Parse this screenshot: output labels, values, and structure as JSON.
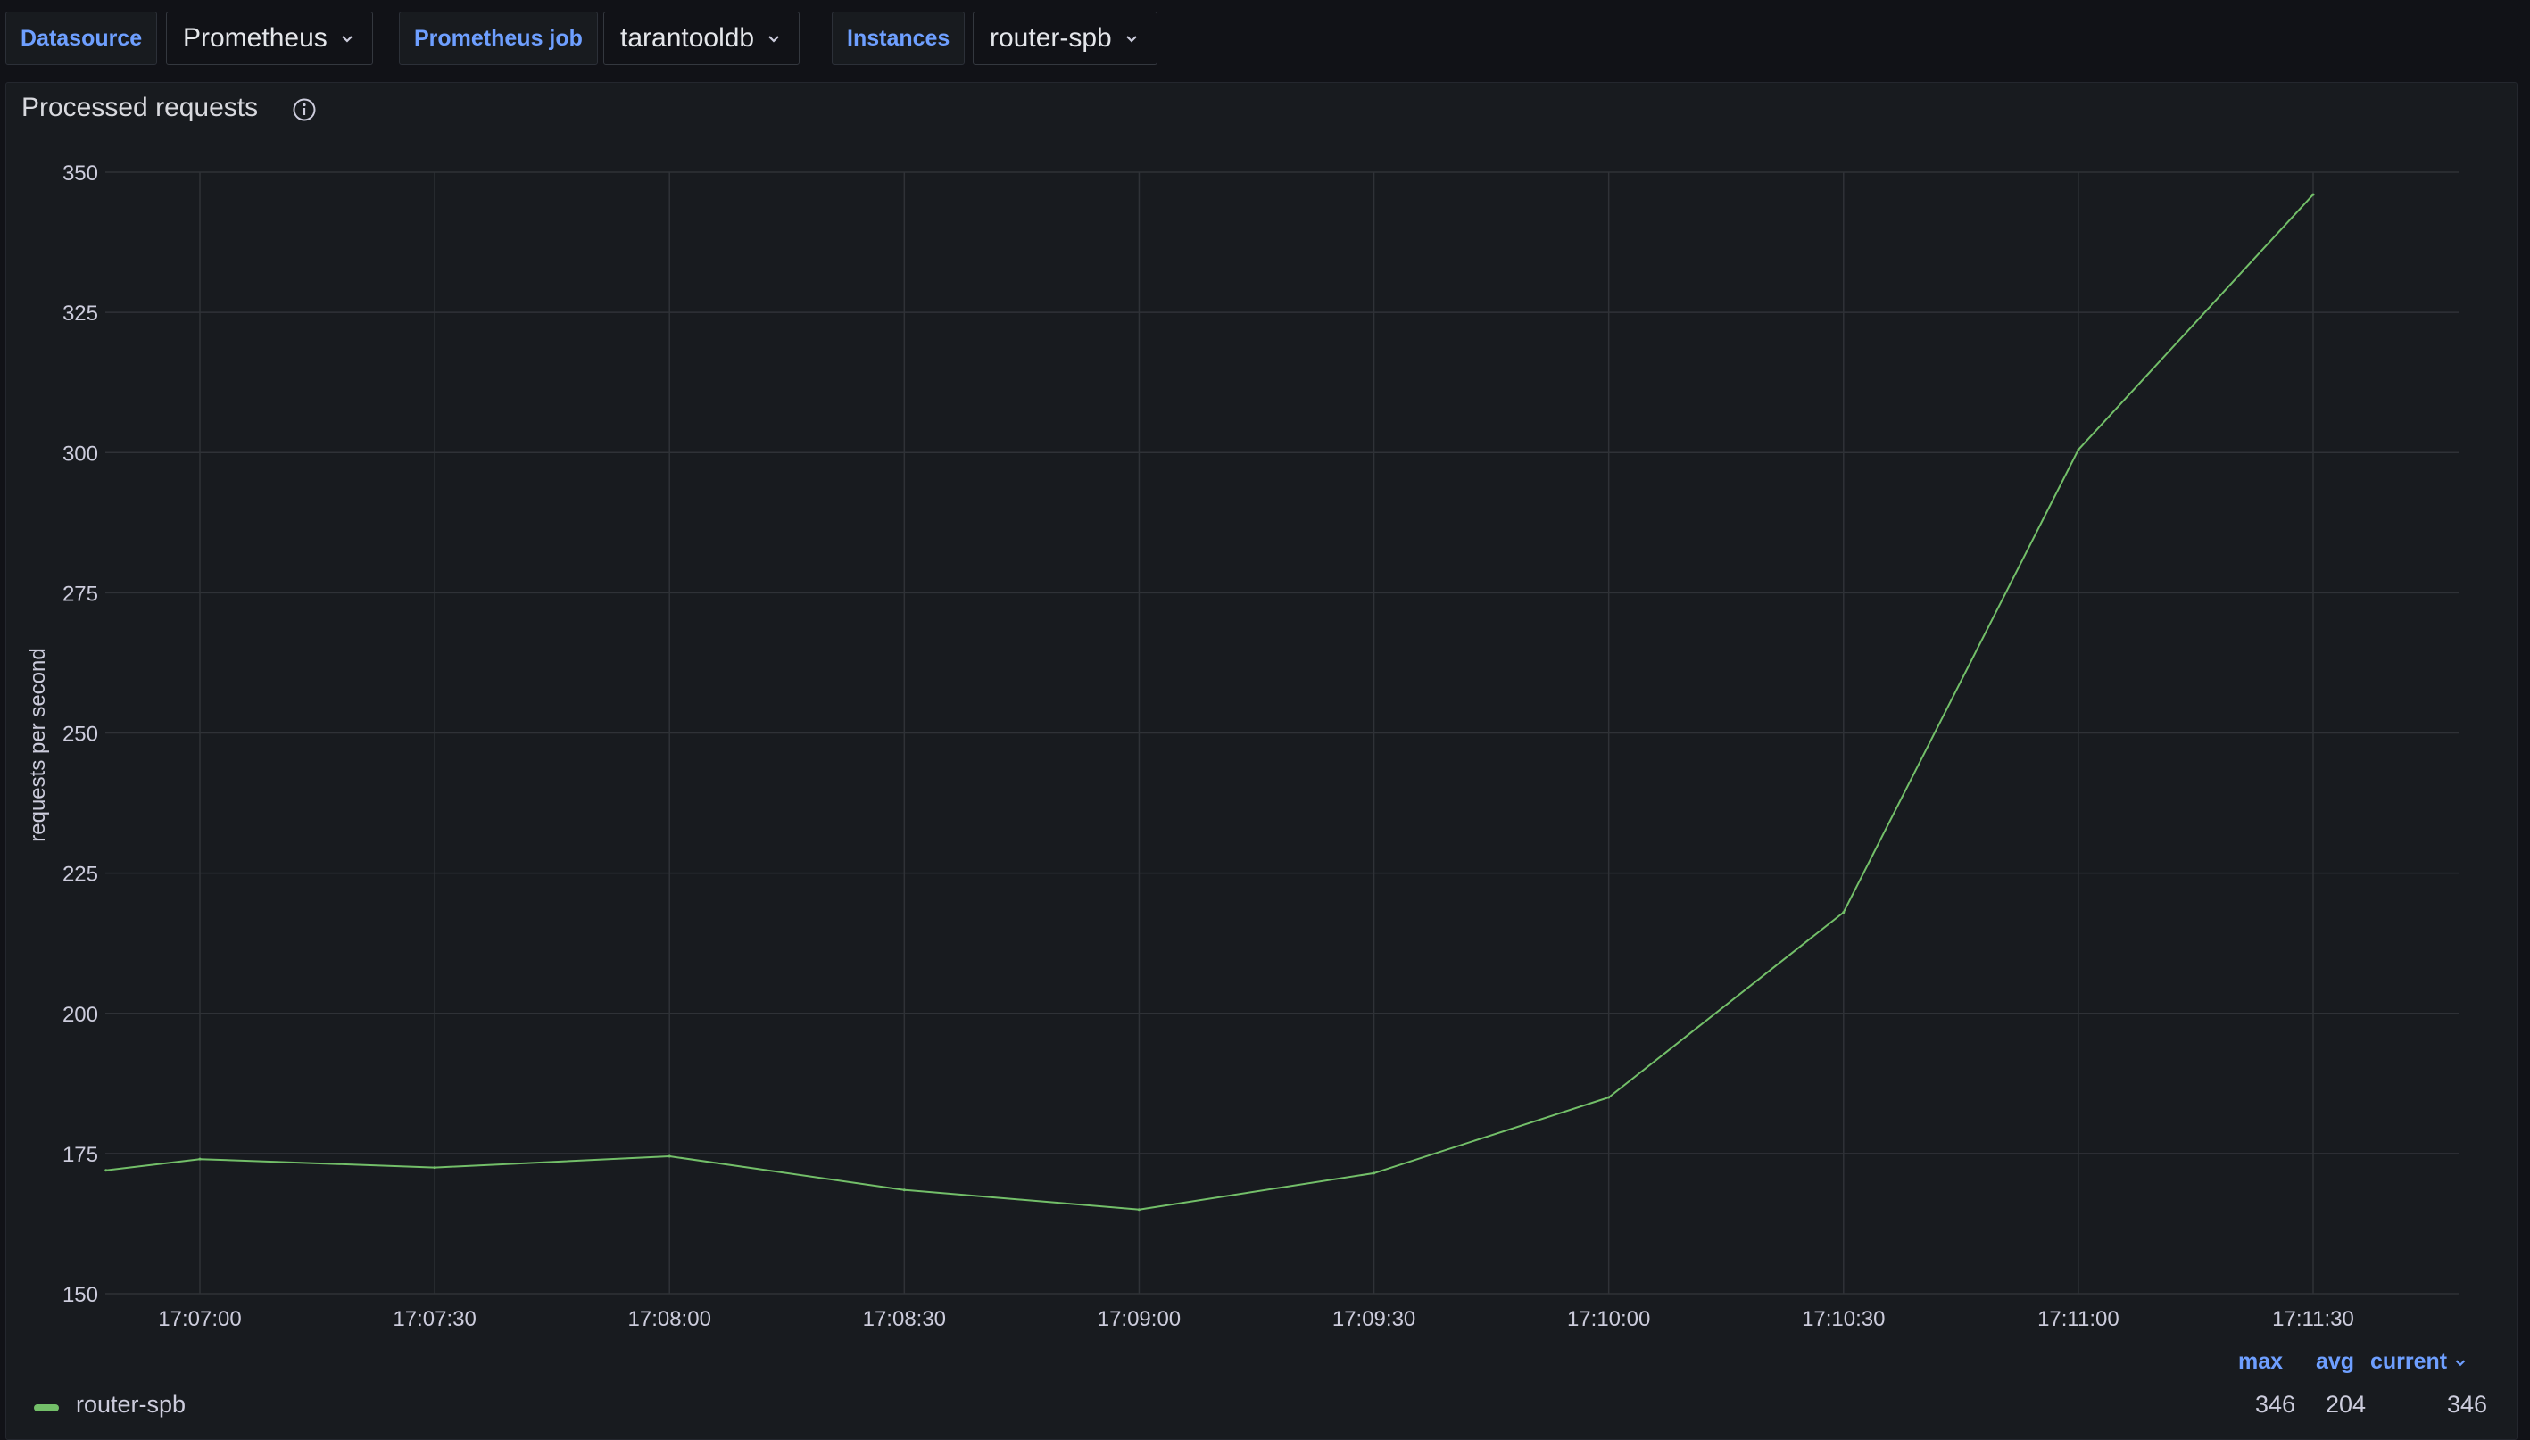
{
  "variables": [
    {
      "label": "Datasource",
      "value": "Prometheus"
    },
    {
      "label": "Prometheus job",
      "value": "tarantooldb"
    },
    {
      "label": "Instances",
      "value": "router-spb"
    }
  ],
  "panel": {
    "title": "Processed requests",
    "legend": {
      "columns": [
        "max",
        "avg",
        "current"
      ],
      "series": [
        {
          "name": "router-spb",
          "color": "#73bf69",
          "max": "346",
          "avg": "204",
          "current": "346"
        }
      ]
    }
  },
  "colors": {
    "line": "#73bf69",
    "grid": "#2f3237",
    "accent": "#6e9fff"
  },
  "icons": {
    "dropdown": "chevron-down-icon",
    "info": "info-icon"
  },
  "chart_data": {
    "type": "line",
    "ylabel": "requests per second",
    "xlabel": "",
    "ylim": [
      150,
      350
    ],
    "y_ticks": [
      "350",
      "325",
      "300",
      "275",
      "250",
      "225",
      "200",
      "175",
      "150"
    ],
    "x_ticks": [
      "17:07:00",
      "17:07:30",
      "17:08:00",
      "17:08:30",
      "17:09:00",
      "17:09:30",
      "17:10:00",
      "17:10:30",
      "17:11:00",
      "17:11:30"
    ],
    "grid": true,
    "legend_position": "bottom",
    "series": [
      {
        "name": "router-spb",
        "color": "#73bf69",
        "x": [
          "17:06:48",
          "17:07:00",
          "17:07:30",
          "17:08:00",
          "17:08:30",
          "17:09:00",
          "17:09:30",
          "17:10:00",
          "17:10:30",
          "17:11:00",
          "17:11:30"
        ],
        "values": [
          172,
          174,
          172.5,
          174.5,
          168.5,
          165,
          171.5,
          185,
          218,
          300.5,
          346
        ]
      }
    ]
  }
}
